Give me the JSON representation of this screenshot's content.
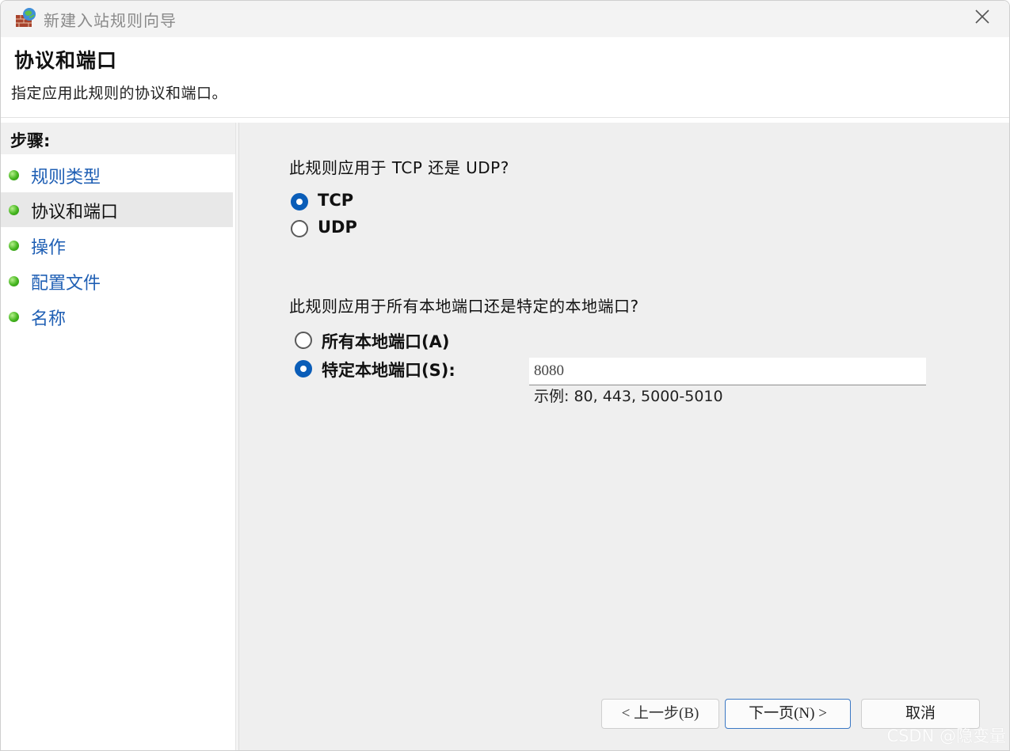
{
  "window": {
    "title": "新建入站规则向导"
  },
  "header": {
    "title": "协议和端口",
    "subtitle": "指定应用此规则的协议和端口。"
  },
  "sidebar": {
    "steps_label": "步骤:",
    "items": [
      {
        "label": "规则类型",
        "active": false
      },
      {
        "label": "协议和端口",
        "active": true
      },
      {
        "label": "操作",
        "active": false
      },
      {
        "label": "配置文件",
        "active": false
      },
      {
        "label": "名称",
        "active": false
      }
    ]
  },
  "main": {
    "protocol_question": "此规则应用于 TCP 还是 UDP?",
    "protocol_options": [
      {
        "label": "TCP",
        "checked": true
      },
      {
        "label": "UDP",
        "checked": false
      }
    ],
    "port_question": "此规则应用于所有本地端口还是特定的本地端口?",
    "port_options": [
      {
        "label": "所有本地端口(A)",
        "checked": false
      },
      {
        "label": "特定本地端口(S):",
        "checked": true
      }
    ],
    "port_value": "8080",
    "port_example": "示例: 80, 443, 5000-5010"
  },
  "buttons": {
    "back": "< 上一步(B)",
    "next": "下一页(N) >",
    "cancel": "取消"
  },
  "watermark": "CSDN @隐变量",
  "colors": {
    "link": "#1f5fb4",
    "accent": "#0a5db8",
    "content_bg": "#efefef",
    "titlebar_bg": "#f3f3f3"
  }
}
